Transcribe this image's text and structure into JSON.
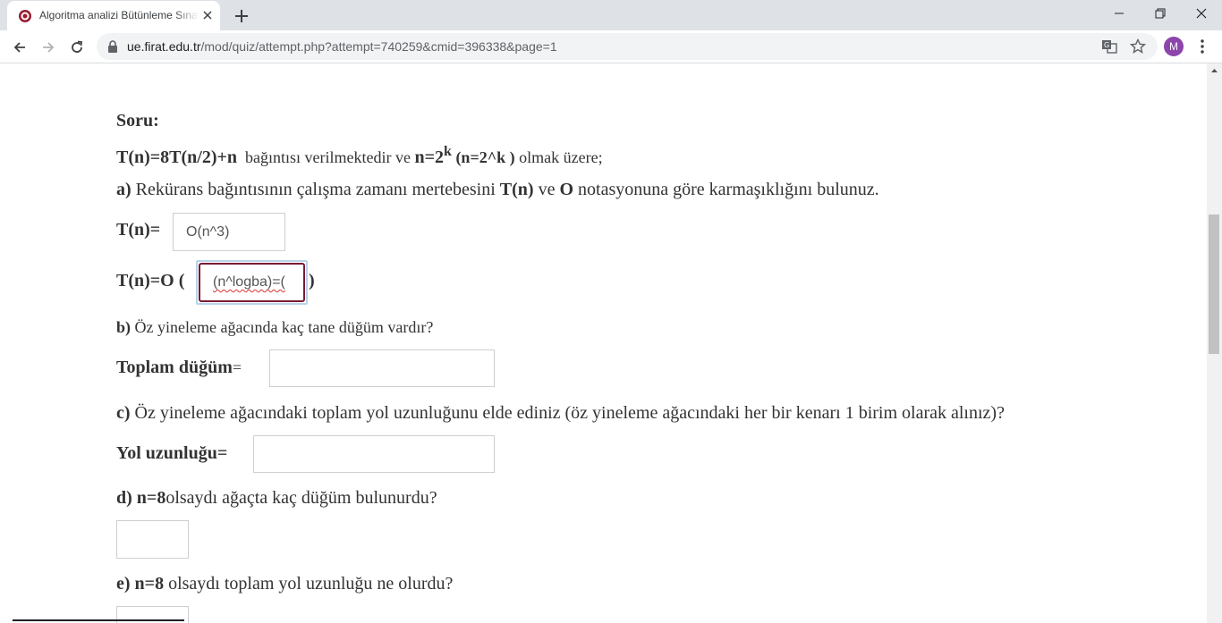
{
  "browser": {
    "tab_title": "Algoritma analizi Bütünleme Sınavı",
    "url_host": "ue.firat.edu.tr",
    "url_path": "/mod/quiz/attempt.php?attempt=740259&cmid=396338&page=1",
    "avatar_letter": "M",
    "avatar_color": "#8e44ad"
  },
  "question": {
    "heading": "Soru:",
    "intro": {
      "formula": "T(n)=8T(n/2)+n",
      "text1": "bağıntısı verilmektedir ve",
      "n_eq": "n=2",
      "exp": "k",
      "paren": "(n=2^k )",
      "text2": "olmak üzere;"
    },
    "a": {
      "label": "a)",
      "text1": "Rekürans bağıntısının çalışma zamanı mertebesini",
      "tn": "T(n)",
      "text2": "ve",
      "o": "O",
      "text3": "notasyonuna göre karmaşıklığını bulunuz.",
      "tn_label": "T(n)=",
      "tn_value": "O(n^3)",
      "to_label": "T(n)=O (",
      "to_value": "(n^logba)=(",
      "to_close": ")"
    },
    "b": {
      "label": "b)",
      "text": "Öz yineleme ağacında kaç tane düğüm vardır?",
      "field_label": "Toplam düğüm",
      "eq": "=",
      "value": ""
    },
    "c": {
      "label": "c)",
      "text": "Öz yineleme ağacındaki toplam yol uzunluğunu elde ediniz (öz yineleme ağacındaki her bir kenarı 1 birim olarak alınız)?",
      "field_label": "Yol uzunluğu=",
      "value": ""
    },
    "d": {
      "label": "d)",
      "bold": "n=8",
      "text": "olsaydı ağaçta kaç düğüm bulunurdu?",
      "value": ""
    },
    "e": {
      "label": "e)",
      "bold": "n=8",
      "text": "olsaydı toplam yol uzunluğu ne olurdu?",
      "value": ""
    }
  }
}
